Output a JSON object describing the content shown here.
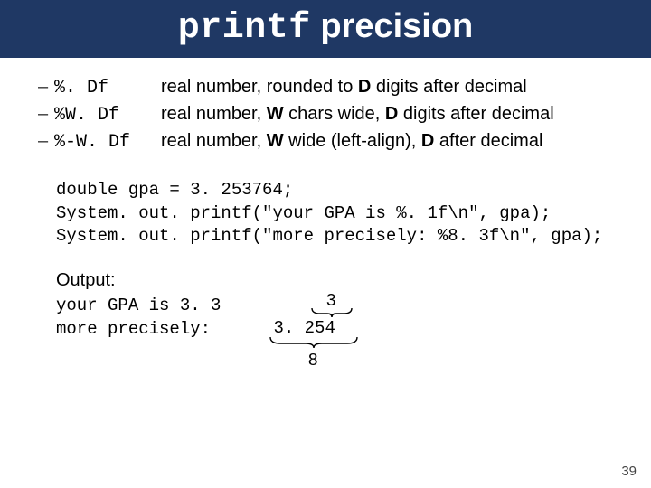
{
  "title": {
    "mono": "printf",
    "rest": " precision"
  },
  "specs": [
    {
      "fmt": "%. Df",
      "desc_pre": "real number, rounded to ",
      "b1": "D",
      "desc_post": " digits after decimal"
    },
    {
      "fmt": "%W. Df",
      "desc_pre": "real number, ",
      "b1": "W",
      "mid": " chars wide, ",
      "b2": "D",
      "desc_post": " digits after decimal"
    },
    {
      "fmt": "%-W. Df",
      "desc_pre": "real number, ",
      "b1": "W",
      "mid": " wide (left-align), ",
      "b2": "D",
      "desc_post": " after decimal"
    }
  ],
  "code": "double gpa = 3. 253764;\nSystem. out. printf(\"your GPA is %. 1f\\n\", gpa);\nSystem. out. printf(\"more precisely: %8. 3f\\n\", gpa);",
  "output_label": "Output:",
  "output_text": "your GPA is 3. 3\nmore precisely:",
  "diagram": {
    "top_num": "3",
    "second_line": "3. 254",
    "bot_num": "8"
  },
  "page": "39"
}
